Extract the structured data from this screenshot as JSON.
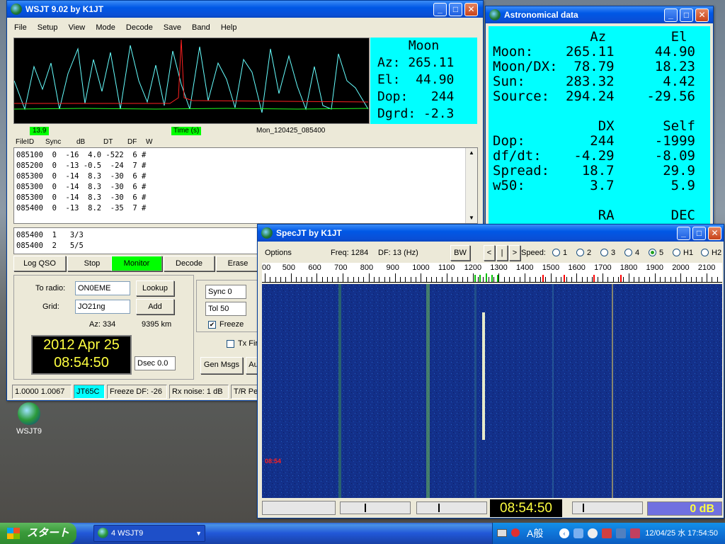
{
  "main_window": {
    "title": "WSJT 9.02    by K1JT",
    "menu": [
      "File",
      "Setup",
      "View",
      "Mode",
      "Decode",
      "Save",
      "Band",
      "Help"
    ],
    "plot_left_label": "13.9",
    "plot_mid_label": "Time (s)",
    "plot_filename": "Mon_120425_085400",
    "moon": {
      "header": "Moon",
      "az": "Az: 265.11",
      "el": "El:  44.90",
      "dop": "Dop:   244",
      "dgrd": "Dgrd: -2.3"
    },
    "columns": [
      "FileID",
      "Sync",
      "dB",
      "DT",
      "DF",
      "W"
    ],
    "decode_rows": [
      "085100  0  -16  4.0 -522  6 #",
      "085200  0  -13 -0.5  -24  7 #",
      "085300  0  -14  8.3  -30  6 #",
      "085300  0  -14  8.3  -30  6 #",
      "085300  0  -14  8.3  -30  6 #",
      "085400  0  -13  8.2  -35  7 #"
    ],
    "avg_rows": [
      "085400  1   3/3",
      "085400  2   5/5"
    ],
    "buttons": {
      "log_qso": "Log QSO",
      "stop": "Stop",
      "monitor": "Monitor",
      "decode": "Decode",
      "erase": "Erase",
      "lookup": "Lookup",
      "add": "Add",
      "gen_msgs": "Gen Msgs",
      "au": "Au"
    },
    "to_radio_label": "To radio:",
    "to_radio_value": "ON0EME",
    "grid_label": "Grid:",
    "grid_value": "JO21ng",
    "az_text": "Az: 334",
    "distance_text": "9395 km",
    "clock_date": "2012 Apr 25",
    "clock_time": "08:54:50",
    "dsec": "Dsec  0.0",
    "sync": "Sync    0",
    "tol": "Tol    50",
    "freeze": "Freeze",
    "txfirst": "Tx Fir",
    "status": {
      "ratio": "1.0000 1.0067",
      "mode": "JT65C",
      "freeze_df": "Freeze DF:  -26",
      "rx_noise": "Rx noise:  1 dB",
      "tr": "T/R Pe"
    },
    "accent": "#00ff00"
  },
  "astro_window": {
    "title": "Astronomical data",
    "rows": [
      "            Az        El",
      "Moon:    265.11     44.90",
      "Moon/DX:  78.79     18.23",
      "Sun:     283.32      4.42",
      "Source:  294.24    -29.56",
      "",
      "             DX      Self",
      "Dop:        244     -1999",
      "df/dt:    -4.29     -8.09",
      "Spread:    18.7      29.9",
      "w50:        3.7       5.9",
      "",
      "             RA       DEC"
    ]
  },
  "spec_window": {
    "title": "SpecJT     by K1JT",
    "options": "Options",
    "freq": "Freq:  1284",
    "df": "DF:   13  (Hz)",
    "bw": "BW",
    "nav": [
      "<",
      "|",
      ">"
    ],
    "speed_label": "Speed:",
    "speeds": [
      "1",
      "2",
      "3",
      "4",
      "5",
      "H1",
      "H2"
    ],
    "selected_speed": "5",
    "scale_labels": [
      "00",
      "500",
      "600",
      "700",
      "800",
      "900",
      "1000",
      "1100",
      "1200",
      "1300",
      "1400",
      "1500",
      "1600",
      "1700",
      "1800",
      "1900",
      "2000",
      "2100"
    ],
    "time_marker": "08:54",
    "clock": "08:54:50",
    "level": "0 dB"
  },
  "desktop": {
    "icon_label": "WSJT9"
  },
  "taskbar": {
    "start": "スタート",
    "task": "4 WSJT9",
    "tray_text": "A般",
    "clock": "12/04/25 水 17:54:50"
  }
}
